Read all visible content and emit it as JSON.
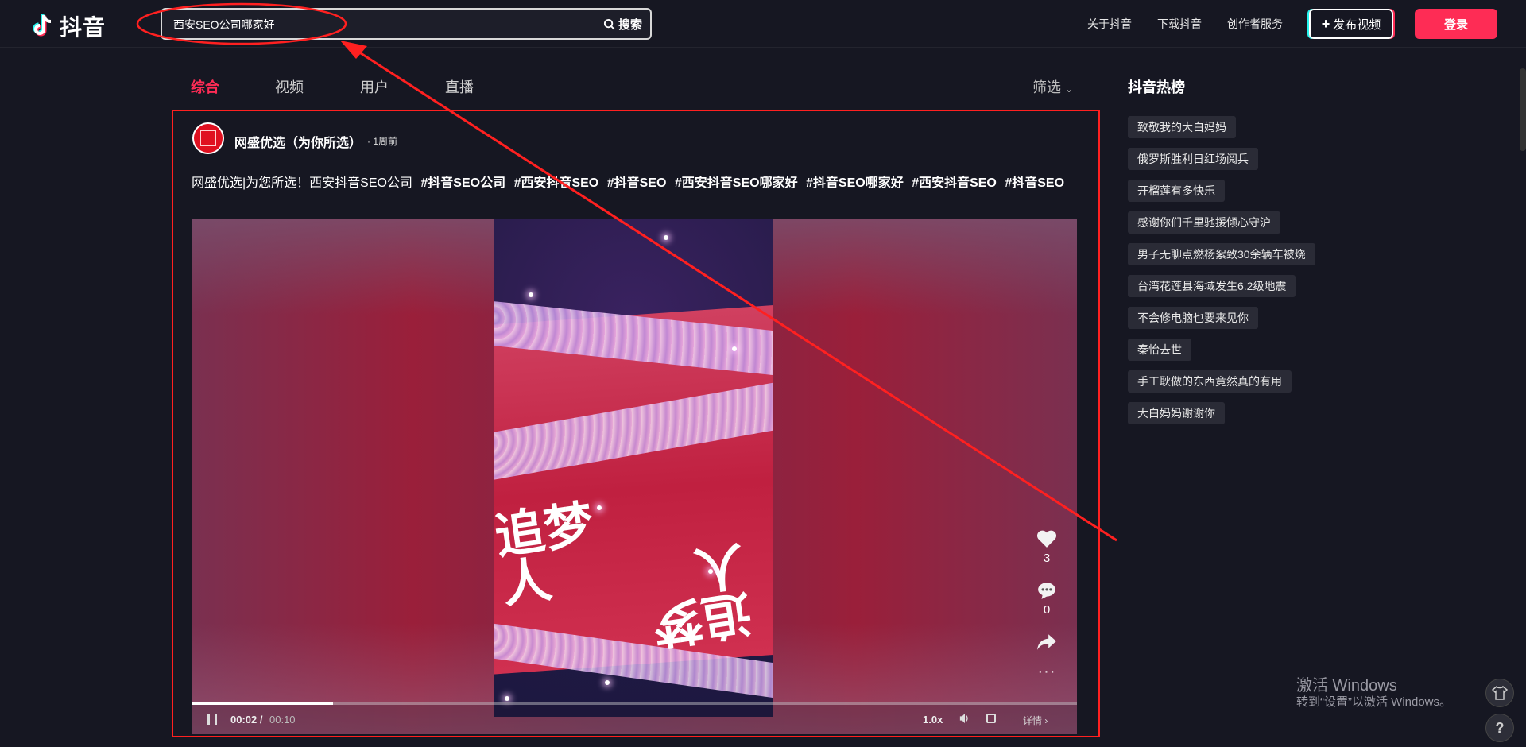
{
  "header": {
    "logo_text": "抖音",
    "search_value": "西安SEO公司哪家好",
    "search_button": "搜索",
    "nav": [
      "关于抖音",
      "下载抖音",
      "创作者服务"
    ],
    "publish_button": "发布视频",
    "login_button": "登录"
  },
  "tabs": [
    {
      "label": "综合",
      "active": true
    },
    {
      "label": "视频",
      "active": false
    },
    {
      "label": "用户",
      "active": false
    },
    {
      "label": "直播",
      "active": false
    }
  ],
  "filter_label": "筛选",
  "result": {
    "author": "网盛优选（为你所选）",
    "time": "· 1周前",
    "desc_text": "网盛优选|为您所选！西安抖音SEO公司",
    "tags": [
      "#抖音SEO公司",
      "#西安抖音SEO",
      "#抖音SEO",
      "#西安抖音SEO哪家好",
      "#抖音SEO哪家好",
      "#西安抖音SEO",
      "#抖音SEO"
    ],
    "likes": "3",
    "comments": "0",
    "time_current": "00:02 /",
    "time_total": "00:10",
    "speed": "1.0x",
    "detail": "详情 ›",
    "progress": 0.16
  },
  "hot": {
    "title": "抖音热榜",
    "items": [
      "致敬我的大白妈妈",
      "俄罗斯胜利日红场阅兵",
      "开榴莲有多快乐",
      "感谢你们千里驰援倾心守沪",
      "男子无聊点燃杨絮致30余辆车被烧",
      "台湾花莲县海域发生6.2级地震",
      "不会修电脑也要来见你",
      "秦怡去世",
      "手工耿做的东西竟然真的有用",
      "大白妈妈谢谢你"
    ]
  },
  "watermark": {
    "title": "激活 Windows",
    "subtitle": "转到“设置”以激活 Windows。"
  },
  "colors": {
    "accent": "#fe2c55",
    "background": "#161722",
    "annotation": "#ff2020"
  }
}
